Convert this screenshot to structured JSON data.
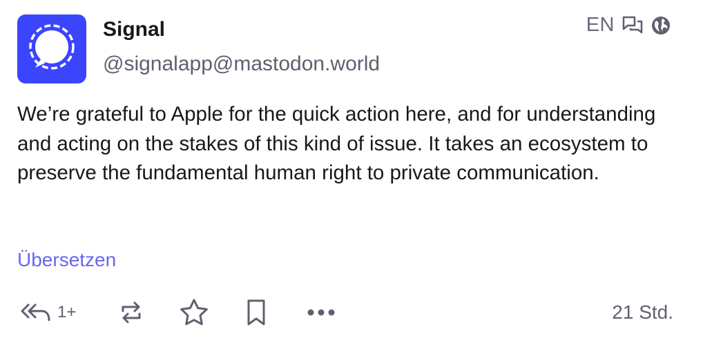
{
  "post": {
    "display_name": "Signal",
    "handle": "@signalapp@mastodon.world",
    "language": "EN",
    "content": "We’re grateful to Apple for the quick action here, and for understanding and acting on the stakes of this kind of issue. It takes an ecosystem to preserve the fundamental human right to private communication.",
    "translate_label": "Übersetzen",
    "timestamp": "21 Std."
  },
  "actions": {
    "reply_count": "1+",
    "icons": [
      "reply-all-icon",
      "boost-icon",
      "star-icon",
      "bookmark-icon",
      "more-icon"
    ]
  },
  "colors": {
    "avatar_bg": "#3b45fd",
    "link": "#6767ee",
    "icon": "#5f5f6e"
  }
}
